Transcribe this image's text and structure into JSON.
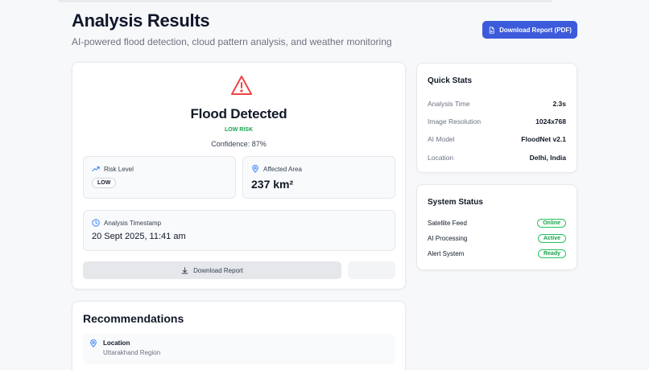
{
  "header": {
    "title": "Analysis Results",
    "subtitle": "AI-powered flood detection, cloud pattern analysis, and weather monitoring",
    "pdf_button": "Download Report (PDF)"
  },
  "result": {
    "icon": "warning-triangle",
    "title": "Flood Detected",
    "risk_label": "LOW RISK",
    "confidence": "Confidence: 87%",
    "risk_level": {
      "label": "Risk Level",
      "value": "LOW"
    },
    "affected_area": {
      "label": "Affected Area",
      "value": "237 km²"
    },
    "timestamp": {
      "label": "Analysis Timestamp",
      "value": "20 Sept 2025, 11:41 am"
    },
    "download_button": "Download Report"
  },
  "quick_stats": {
    "title": "Quick Stats",
    "rows": [
      {
        "label": "Analysis Time",
        "value": "2.3s"
      },
      {
        "label": "Image Resolution",
        "value": "1024x768"
      },
      {
        "label": "AI Model",
        "value": "FloodNet v2.1"
      },
      {
        "label": "Location",
        "value": "Delhi, India"
      }
    ]
  },
  "system_status": {
    "title": "System Status",
    "rows": [
      {
        "label": "Satellite Feed",
        "status": "Online"
      },
      {
        "label": "AI Processing",
        "status": "Active"
      },
      {
        "label": "Alert System",
        "status": "Ready"
      }
    ]
  },
  "recommendations": {
    "title": "Recommendations",
    "items": [
      {
        "title": "Location",
        "subtitle": "Uttarakhand Region"
      }
    ]
  },
  "colors": {
    "primary": "#3b5bdb",
    "danger": "#ef4444",
    "success": "#16a34a",
    "info": "#3b82f6"
  }
}
